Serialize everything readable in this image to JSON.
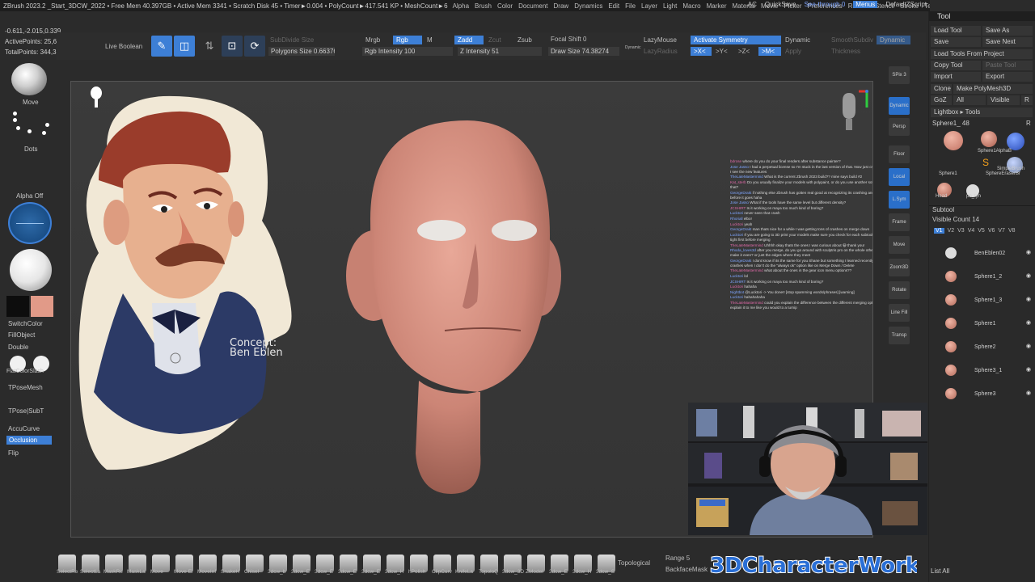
{
  "menubar": {
    "status": "ZBrush 2023.2 _Start_3DCW_2022 • Free Mem 40.397GB • Active Mem 3341 • Scratch Disk 45 • Timer►0.004 • PolyCount►417.541 KP • MeshCount►6",
    "menus": [
      "Alpha",
      "Brush",
      "Color",
      "Document",
      "Draw",
      "Dynamics",
      "Edit",
      "File",
      "Layer",
      "Light",
      "Macro",
      "Marker",
      "Material",
      "Movie",
      "Picker",
      "Preferences",
      "Render",
      "Stencil",
      "Stroke",
      "Texture",
      "Tool",
      "Transform",
      "Zplugin",
      "Zscript",
      "Help"
    ],
    "ac": "AC",
    "quicksave": "QuickSave",
    "see_through": "See-through  0",
    "menus_btn": "Menus",
    "default_script": "DefaultZScript"
  },
  "info": {
    "coords": "-0.611,-2.015,0.339",
    "active_points": "ActivePoints: 25,641",
    "total_points": "TotalPoints: 344,393"
  },
  "shelf": {
    "live_boolean": "Live Boolean",
    "subdivide_size": "SubDivide Size",
    "polygons_size": "Polygons Size 0.66376",
    "mrgb": "Mrgb",
    "rgb": "Rgb",
    "m": "M",
    "rgb_intensity": "Rgb Intensity 100",
    "zadd": "Zadd",
    "zsub": "Zsub",
    "zcut": "Zcut",
    "z_intensity": "Z Intensity 51",
    "focal_shift": "Focal Shift 0",
    "draw_size": "Draw Size 74.38274",
    "dynamic_small": "Dynamic",
    "lazymouse": "LazyMouse",
    "lazyradius": "LazyRadius",
    "activate_symmetry": "Activate Symmetry",
    "dynamic": "Dynamic",
    "x_axis": ">X<",
    "y_axis": ">Y<",
    "z_axis": ">Z<",
    "m_axis": ">M<",
    "apply": "Apply",
    "smooth_subdiv": "SmoothSubdiv",
    "thickness": "Thickness",
    "dynamic_btn": "Dynamic"
  },
  "lefttray": {
    "move": "Move",
    "dots": "Dots",
    "alpha_off": "Alpha Off",
    "switch_color": "SwitchColor",
    "fill_object": "FillObject",
    "double": "Double",
    "flat_color": "FlatColorSlash",
    "tpose_mesh": "TPoseMesh",
    "tpose_subt": "TPose|SubT",
    "accucurve": "AccuCurve",
    "occlusion": "Occlusion",
    "flip": "Flip"
  },
  "canvas": {
    "concept_title": "Concept:",
    "concept_author": "Ben Eblen"
  },
  "chat": [
    {
      "user": "bdrose",
      "text": "where do you do your final renders after substance painter?"
    },
    {
      "user": "Jose Jasso",
      "text": "I had a perpetual license so I'm stuck in the last version of that. Now just cry whenever I see the new features"
    },
    {
      "user": "TheLateMastermind",
      "text": "What is the current Zbrush 2023 build?? mine says build #2"
    },
    {
      "user": "Kat_sterb",
      "text": "Do you usually finalize your models with polypaint, or do you use another software for that?"
    },
    {
      "user": "GeorgeDrakt",
      "text": "if nothing else Zbrush has gotten real good at recognizing its crashing and saving before it goes haha"
    },
    {
      "user": "Jose Jasso",
      "text": "What if the tools have the same level but different density?"
    },
    {
      "user": "JCSHIRT",
      "text": "Is it working on maya too much kind of boring?"
    },
    {
      "user": "Lucktori",
      "text": "never seen that crash"
    },
    {
      "user": "Rhoriall",
      "text": "elbo!"
    },
    {
      "user": "Lucktori",
      "text": "yeah"
    },
    {
      "user": "GeorgeDrakt",
      "text": "man thats nice for a while I was getting tons of crashes on merge down"
    },
    {
      "user": "Lucktori",
      "text": "If you are going to 3D print your models make sure you check for each subtool is water tight first before merging"
    },
    {
      "user": "TheLateMastermind",
      "text": "Uhhhh okay thats the ones I was curious about 😀 thank you!"
    },
    {
      "user": "Rhoda_loves3d",
      "text": "after you merge, do you go around with sculptris pro on the whole other subtool to make it even? or just the edges where they meet"
    },
    {
      "user": "GeorgeDrakt",
      "text": "I dont know if its the same for you Shane but something I learned recently is I get less crashes when I don't do the \"always ok\" option like on Merge Down / Delete"
    },
    {
      "user": "TheLateMastermind",
      "text": "what about the ones in the gear icon menu options??"
    },
    {
      "user": "Lucktori",
      "text": "lol"
    },
    {
      "user": "JCSHIRT",
      "text": "Is it working on maya too much kind of boring?"
    },
    {
      "user": "Lucktori",
      "text": "hahaha"
    },
    {
      "user": "Nightbot",
      "text": "@Lucktori -> You done!! [stop spamming words/phrases] [warning]"
    },
    {
      "user": "Lucktori",
      "text": "hahahahaha"
    },
    {
      "user": "TheLateMastermind",
      "text": "could you explain the difference between the different merging options? explain it to me like you would to a turnip"
    }
  ],
  "rcol": [
    "SPix 3",
    "Dynamic",
    "Persp",
    "Floor",
    "Local",
    "L.Sym",
    "Frame",
    "Move",
    "Zoom3D",
    "Rotate",
    "Line Fill",
    "Transp"
  ],
  "rpanel": {
    "title": "Tool",
    "load_tool": "Load Tool",
    "save_as": "Save As",
    "save": "Save",
    "save_next": "Save Next",
    "load_tools_project": "Load Tools From Project",
    "copy_tool": "Copy Tool",
    "paste_tool": "Paste Tool",
    "import": "Import",
    "export": "Export",
    "clone": "Clone",
    "make_polymesh": "Make PolyMesh3D",
    "goz": "GoZ",
    "all": "All",
    "visible": "Visible",
    "r": "R",
    "lightbox_tools": "Lightbox ▸ Tools",
    "current_tool": "Sphere1_ 48",
    "r2": "R",
    "tool_thumbs": [
      "Sphere1",
      "Sphere1AlphaB",
      "SimpleBrush",
      "SphereEraserBr",
      "Head",
      "pb_tyn"
    ],
    "subtool": "Subtool",
    "visible_count": "Visible Count 14",
    "versions": [
      "V1",
      "V2",
      "V3",
      "V4",
      "V5",
      "V6",
      "V7",
      "V8"
    ],
    "subtools": [
      "BenEblen02",
      "Sphere1_2",
      "Sphere1_3",
      "Sphere1",
      "Sphere2",
      "Sphere3_1",
      "Sphere3"
    ],
    "list_all": "List All"
  },
  "bottom": {
    "labels": [
      "SelectRe",
      "SelectLa",
      "MaskRe",
      "MaskLa",
      "Move",
      "Move El",
      "MoveInf",
      "SnakeH",
      "Chisel",
      "3dcw_b",
      "3dcw_E",
      "3dcw_E",
      "3dcw_E",
      "3dcw_E",
      "3dcw_H",
      "hPolish",
      "ClipCurv",
      "KnifeLa",
      "TopoloQ",
      "3dcw_3D",
      "ZModel",
      "3dcw_E",
      "3dcw_H",
      "3dcw_S"
    ],
    "topological": "Topological",
    "range": "Range 5",
    "backface": "BackfaceMask"
  },
  "logo": "3DCharacterWorkshop",
  "colors": {
    "accent": "#3d7fd6",
    "skin": "#e19a88",
    "panel": "#2a2a2a"
  }
}
